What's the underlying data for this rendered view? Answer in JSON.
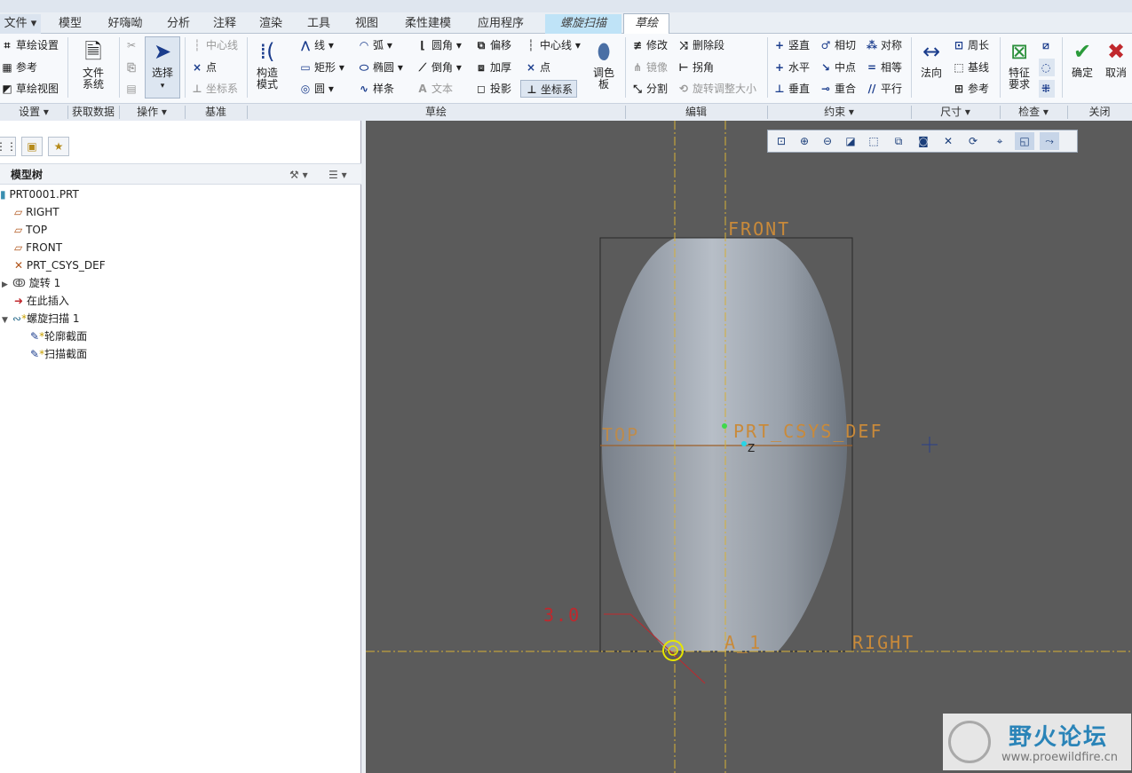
{
  "tabs": [
    {
      "label": "文件 ▾"
    },
    {
      "label": "模型"
    },
    {
      "label": "好嗨呦"
    },
    {
      "label": "分析"
    },
    {
      "label": "注释"
    },
    {
      "label": "渲染"
    },
    {
      "label": "工具"
    },
    {
      "label": "视图"
    },
    {
      "label": "柔性建模"
    },
    {
      "label": "应用程序"
    },
    {
      "label": "螺旋扫描"
    },
    {
      "label": "草绘"
    }
  ],
  "ribbon": {
    "setup": {
      "sketch_setup": "草绘设置",
      "reference": "参考",
      "sketch_view": "草绘视图"
    },
    "get_data": {
      "file_system": "文件\n系统"
    },
    "operations": {
      "select": "选择"
    },
    "datum": {
      "centerline": "中心线",
      "point": "点",
      "csys": "坐标系"
    },
    "sketch": {
      "construction": "构造\n模式",
      "line": "线",
      "arc": "弧",
      "fillet": "圆角",
      "offset": "偏移",
      "centerline": "中心线",
      "rectangle": "矩形",
      "ellipse": "椭圆",
      "chamfer": "倒角",
      "thicken": "加厚",
      "point": "点",
      "circle": "圆",
      "spline": "样条",
      "text": "文本",
      "project": "投影",
      "csys": "坐标系",
      "palette": "调色\n板"
    },
    "edit": {
      "modify": "修改",
      "delete_segment": "删除段",
      "mirror": "镜像",
      "corner": "拐角",
      "divide": "分割",
      "rotate_resize": "旋转调整大小"
    },
    "constrain": {
      "vertical": "竖直",
      "tangent": "相切",
      "symmetric": "对称",
      "horizontal": "水平",
      "midpoint": "中点",
      "equal": "相等",
      "perpendicular": "垂直",
      "coincident": "重合",
      "parallel": "平行"
    },
    "dimension": {
      "normal": "法向",
      "perimeter": "周长",
      "baseline": "基线",
      "reference": "参考"
    },
    "inspect": {
      "feature_requirements": "特征\n要求"
    },
    "close": {
      "ok": "确定",
      "cancel": "取消"
    }
  },
  "groups": [
    "设置 ▾",
    "获取数据",
    "操作 ▾",
    "基准",
    "草绘",
    "编辑",
    "约束 ▾",
    "尺寸 ▾",
    "检查 ▾",
    "关闭"
  ],
  "model_tree": {
    "title": "模型树",
    "items": [
      {
        "label": "PRT0001.PRT"
      },
      {
        "label": "RIGHT"
      },
      {
        "label": "TOP"
      },
      {
        "label": "FRONT"
      },
      {
        "label": "PRT_CSYS_DEF"
      },
      {
        "label": "旋转 1"
      },
      {
        "label": "在此插入"
      },
      {
        "label": "螺旋扫描 1"
      },
      {
        "label": "轮廓截面"
      },
      {
        "label": "扫描截面"
      }
    ]
  },
  "canvas": {
    "front_label": "FRONT",
    "top_label": "TOP",
    "right_label": "RIGHT",
    "csys_label": "PRT_CSYS_DEF",
    "axis_label": "A_1",
    "dimension_value": "3.0",
    "z_label": "Z"
  },
  "watermark": {
    "title": "野火论坛",
    "url": "www.proewildfire.cn"
  }
}
